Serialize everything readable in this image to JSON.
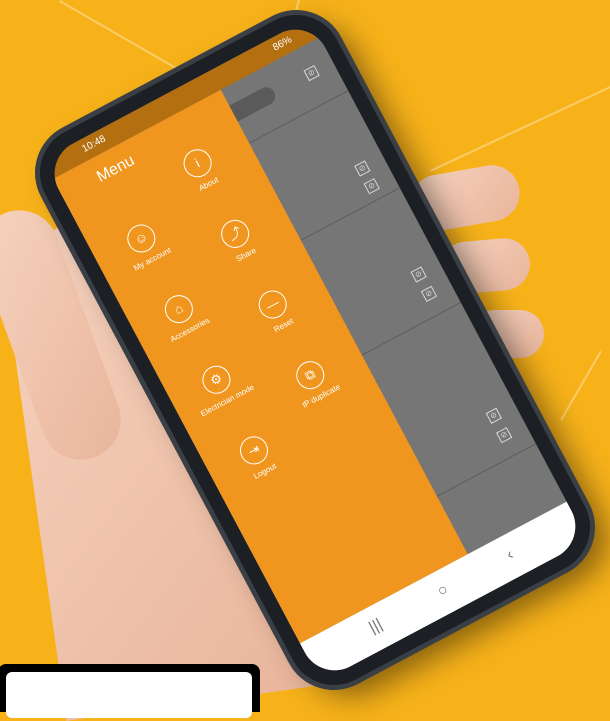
{
  "colors": {
    "background": "#f7b21a",
    "drawer": "#f0961e",
    "status_bar": "#b46f10"
  },
  "status_bar": {
    "time": "10:48",
    "battery": "86%"
  },
  "menu": {
    "title": "Menu",
    "items": [
      {
        "label": "My account",
        "icon": "user-icon"
      },
      {
        "label": "About",
        "icon": "info-icon"
      },
      {
        "label": "Accessories",
        "icon": "accessories-icon"
      },
      {
        "label": "Share",
        "icon": "share-icon"
      },
      {
        "label": "Electrician mode",
        "icon": "gear-icon"
      },
      {
        "label": "Reset",
        "icon": "reset-icon"
      },
      {
        "label": "Logout",
        "icon": "logout-icon"
      },
      {
        "label": "IP duplicate",
        "icon": "duplicate-icon"
      }
    ]
  },
  "nav_bar": {
    "recents": "|||",
    "home": "○",
    "back": "‹"
  }
}
